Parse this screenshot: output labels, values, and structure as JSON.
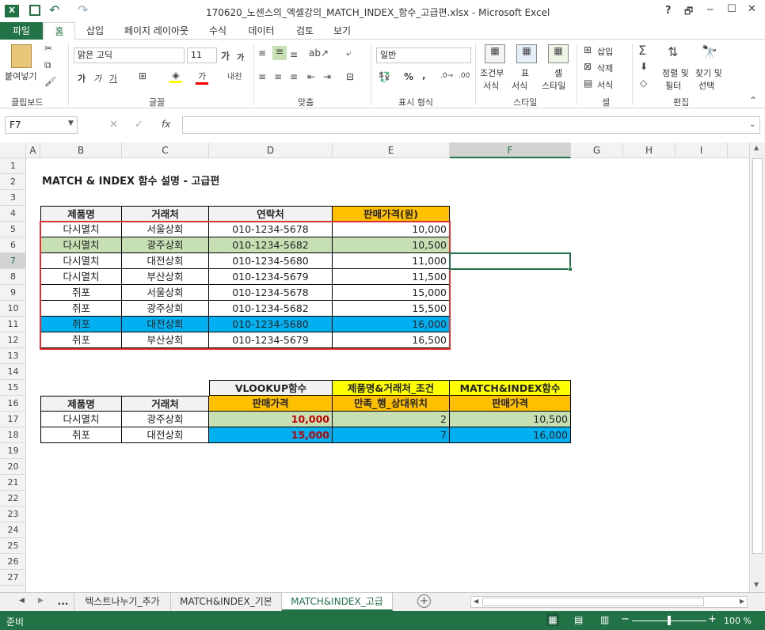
{
  "window": {
    "title": "170620_노센스의_엑셀강의_MATCH_INDEX_함수_고급편.xlsx - Microsoft Excel",
    "help": "?",
    "controls": [
      "🗗",
      "─",
      "☐",
      "✕"
    ]
  },
  "ribbon_tabs": [
    "파일",
    "홈",
    "삽입",
    "페이지 레이아웃",
    "수식",
    "데이터",
    "검토",
    "보기"
  ],
  "ribbon": {
    "clipboard": {
      "paste": "붙여넣기",
      "group": "클립보드"
    },
    "font": {
      "name": "맑은 고딕",
      "size": "11",
      "bold": "가",
      "italic": "가",
      "underline": "가",
      "group": "글꼴"
    },
    "alignment": {
      "group": "맞춤"
    },
    "number": {
      "format": "일반",
      "percent": "%",
      "comma": ",",
      "group": "표시 형식"
    },
    "styles": {
      "conditional": [
        "조건부",
        "서식"
      ],
      "table": [
        "표",
        "서식"
      ],
      "cell": [
        "셀",
        "스타일"
      ],
      "group": "스타일"
    },
    "cells": {
      "insert": "삽입",
      "delete": "삭제",
      "format": "서식",
      "group": "셀"
    },
    "editing": {
      "sort": [
        "정렬 및",
        "필터"
      ],
      "find": [
        "찾기 및",
        "선택"
      ],
      "group": "편집"
    }
  },
  "formula_bar": {
    "name_box": "F7",
    "fx": "fx",
    "value": ""
  },
  "columns": [
    "A",
    "B",
    "C",
    "D",
    "E",
    "F",
    "G",
    "H",
    "I"
  ],
  "rows": [
    "1",
    "2",
    "3",
    "4",
    "5",
    "6",
    "7",
    "8",
    "9",
    "10",
    "11",
    "12",
    "13",
    "14",
    "15",
    "16",
    "17",
    "18",
    "19",
    "20",
    "21",
    "22",
    "23",
    "24",
    "25",
    "26",
    "27"
  ],
  "sheet": {
    "title": "MATCH & INDEX 함수 설명 - 고급편",
    "table1": {
      "headers": [
        "제품명",
        "거래처",
        "연락처",
        "판매가격(원)"
      ],
      "rows": [
        [
          "다시멸치",
          "서울상회",
          "010-1234-5678",
          "10,000"
        ],
        [
          "다시멸치",
          "광주상회",
          "010-1234-5682",
          "10,500"
        ],
        [
          "다시멸치",
          "대전상회",
          "010-1234-5680",
          "11,000"
        ],
        [
          "다시멸치",
          "부산상회",
          "010-1234-5679",
          "11,500"
        ],
        [
          "쥐포",
          "서울상회",
          "010-1234-5678",
          "15,000"
        ],
        [
          "쥐포",
          "광주상회",
          "010-1234-5682",
          "15,500"
        ],
        [
          "쥐포",
          "대전상회",
          "010-1234-5680",
          "16,000"
        ],
        [
          "쥐포",
          "부산상회",
          "010-1234-5679",
          "16,500"
        ]
      ]
    },
    "table2": {
      "top_headers": [
        "VLOOKUP함수",
        "제품명&거래처_조건",
        "MATCH&INDEX함수"
      ],
      "headers": [
        "제품명",
        "거래처",
        "판매가격",
        "만족_행_상대위치",
        "판매가격"
      ],
      "rows": [
        [
          "다시멸치",
          "광주상회",
          "10,000",
          "2",
          "10,500"
        ],
        [
          "쥐포",
          "대전상회",
          "15,000",
          "7",
          "16,000"
        ]
      ]
    }
  },
  "sheet_tabs": [
    "...",
    "텍스트나누기_추가",
    "MATCH&INDEX_기본",
    "MATCH&INDEX_고급"
  ],
  "status": {
    "ready": "준비",
    "zoom": "100 %"
  },
  "colors": {
    "excel_green": "#217346",
    "header_gold": "#ffc000",
    "yellow": "#ffff00",
    "green_fill": "#c6e0b4",
    "blue_fill": "#00b0f0",
    "red_border": "#e03030",
    "red_text": "#c00000",
    "grey_fill": "#f2f2f2"
  }
}
